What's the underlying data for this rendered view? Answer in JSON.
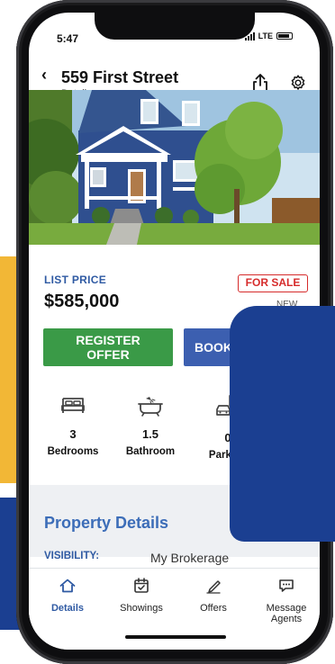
{
  "status_bar": {
    "time": "5:47",
    "network": "LTE"
  },
  "header": {
    "back_glyph": "‹",
    "title": "559 First Street",
    "subtitle": "Details",
    "share_icon": "share-icon",
    "settings_icon": "gear-icon"
  },
  "listing": {
    "price_label": "LIST PRICE",
    "price": "$585,000",
    "status_badge": "FOR SALE",
    "status_note": "NEW"
  },
  "actions": {
    "register_label": "REGISTER OFFER",
    "book_label": "BOOK SH"
  },
  "features": [
    {
      "value": "3",
      "label": "Bedrooms",
      "icon": "bed-icon"
    },
    {
      "value": "1.5",
      "label": "Bathroom",
      "icon": "bathtub-icon"
    },
    {
      "value": "0",
      "label": "Parking",
      "icon": "parking-icon"
    }
  ],
  "property_details": {
    "title": "Property Details",
    "visibility_label": "VISIBILITY:",
    "visibility_value": "My Brokerage"
  },
  "tabs": [
    {
      "label": "Details",
      "icon": "home-icon",
      "active": true
    },
    {
      "label": "Showings",
      "icon": "calendar-check-icon",
      "active": false
    },
    {
      "label": "Offers",
      "icon": "pen-icon",
      "active": false
    },
    {
      "label": "Message Agents",
      "icon": "chat-icon",
      "active": false
    }
  ],
  "colors": {
    "accent_blue": "#2f5aa3",
    "register_green": "#3a9a47",
    "book_blue": "#3c5fb0",
    "sale_red": "#d62b2b",
    "navy_overlay": "#1b3f91",
    "yellow_accent": "#f2b736"
  }
}
